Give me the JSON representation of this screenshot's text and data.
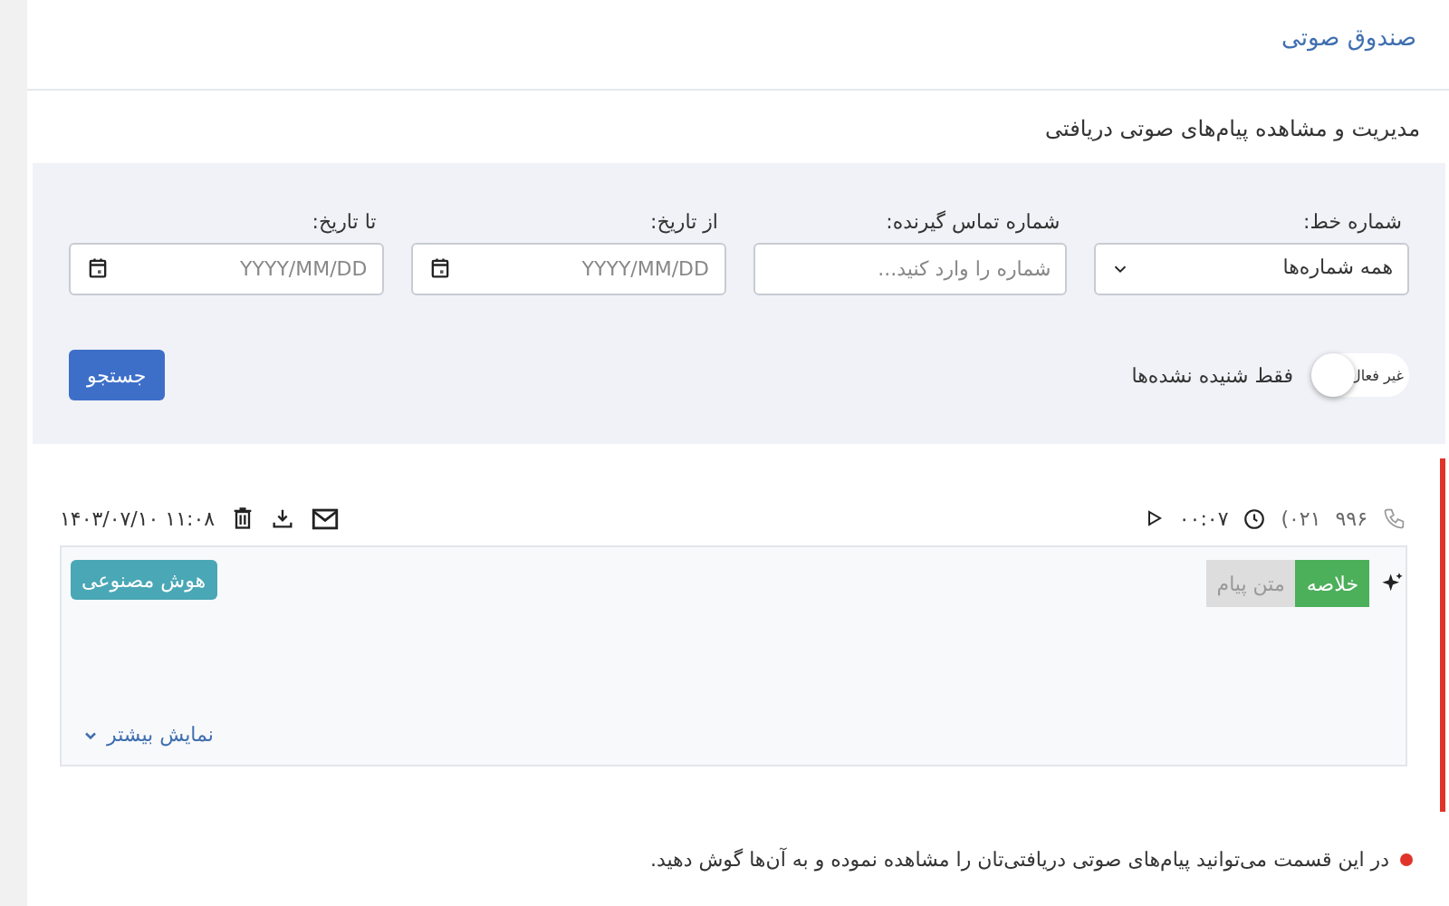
{
  "page": {
    "title": "صندوق صوتی",
    "subtitle": "مدیریت و مشاهده پیام‌های صوتی دریافتی"
  },
  "filters": {
    "fields": [
      {
        "kind": "select",
        "label": "شماره خط:",
        "value": "همه شماره‌ها"
      },
      {
        "kind": "text",
        "label": "شماره تماس گیرنده:",
        "placeholder": "شماره را وارد کنید..."
      },
      {
        "kind": "date",
        "label": "از تاریخ:",
        "placeholder": "YYYY/MM/DD"
      },
      {
        "kind": "date",
        "label": "تا تاریخ:",
        "placeholder": "YYYY/MM/DD"
      }
    ],
    "toggle": {
      "label": "فقط شنیده نشده‌ها",
      "state_text": "غیر فعال",
      "on": false
    },
    "search_button": "جستجو"
  },
  "messages": [
    {
      "unread": true,
      "caller": "۹۹۶",
      "number": "(۰۲۱",
      "duration": "۰۰:۰۷",
      "datetime": "۱۴۰۳/۰۷/۱۰ ۱۱:۰۸",
      "tabs": [
        {
          "label": "خلاصه",
          "selected": true
        },
        {
          "label": "متن پیام",
          "selected": false
        }
      ],
      "ai_button": "هوش مصنوعی",
      "more_link": "نمایش بیشتر"
    }
  ],
  "note": "در این قسمت می‌توانید پیام‌های صوتی دریافتی‌تان را مشاهده نموده و به آن‌ها گوش دهید."
}
